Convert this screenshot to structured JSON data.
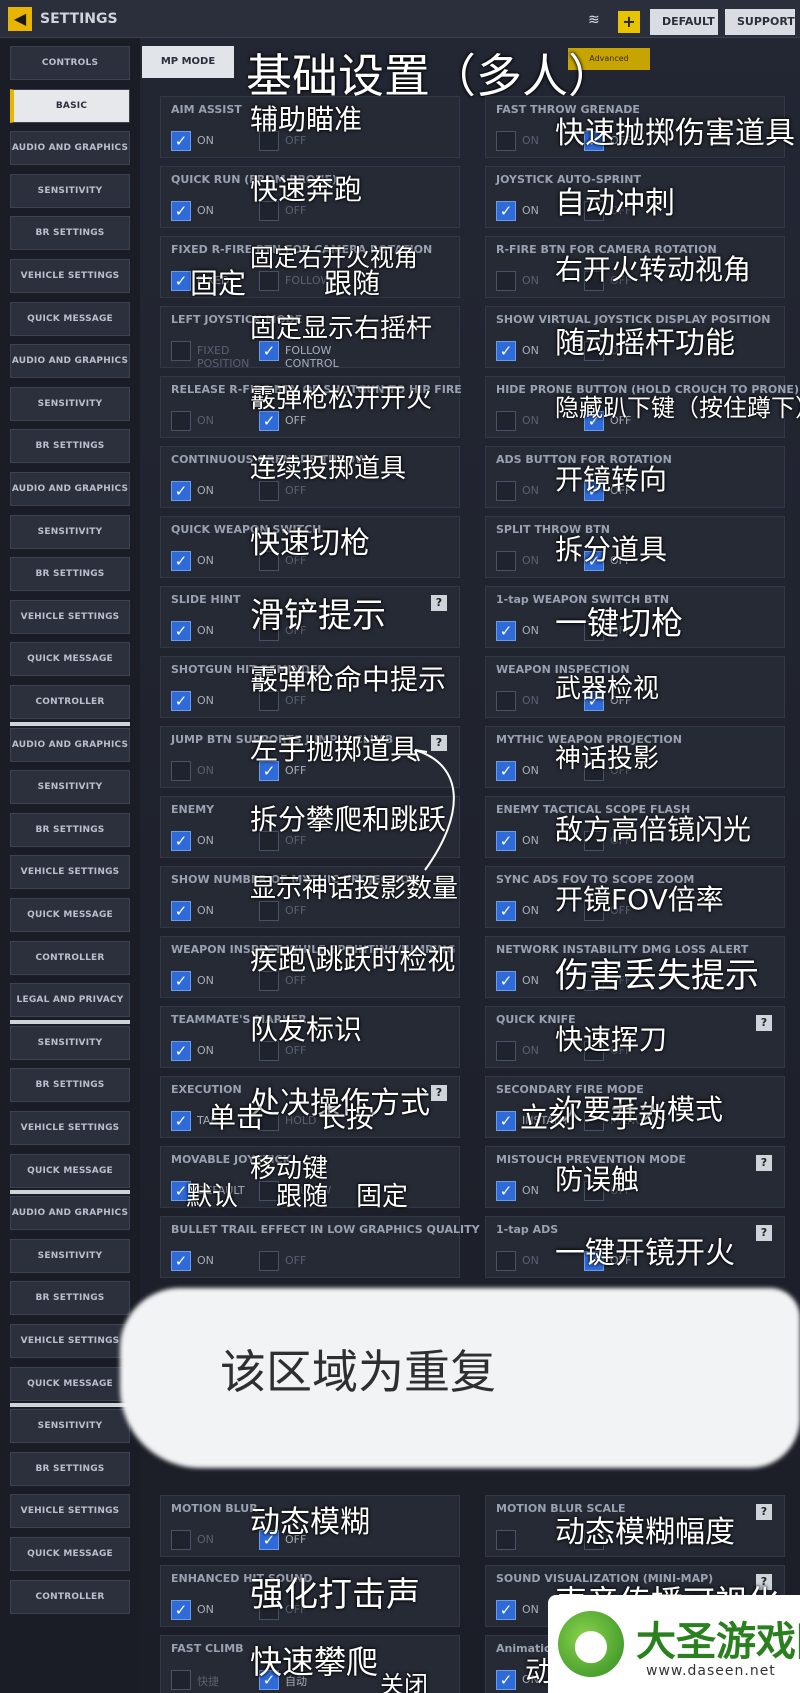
{
  "topbar": {
    "back_icon": "back-arrow-icon",
    "title": "SETTINGS",
    "wifi_icon": "signal-icon",
    "plus": "+",
    "default_label": "DEFAULT",
    "support_label": "SUPPORT"
  },
  "sidebar": {
    "items": [
      "CONTROLS",
      "BASIC",
      "AUDIO AND GRAPHICS",
      "SENSITIVITY",
      "BR SETTINGS",
      "VEHICLE SETTINGS",
      "QUICK MESSAGE",
      "AUDIO AND GRAPHICS",
      "SENSITIVITY",
      "BR SETTINGS",
      "AUDIO AND GRAPHICS",
      "SENSITIVITY",
      "BR SETTINGS",
      "VEHICLE SETTINGS",
      "QUICK MESSAGE",
      "CONTROLLER",
      "AUDIO AND GRAPHICS",
      "SENSITIVITY",
      "BR SETTINGS",
      "VEHICLE SETTINGS",
      "QUICK MESSAGE",
      "CONTROLLER",
      "LEGAL AND PRIVACY",
      "SENSITIVITY",
      "BR SETTINGS",
      "VEHICLE SETTINGS",
      "QUICK MESSAGE",
      "AUDIO AND GRAPHICS",
      "SENSITIVITY",
      "BR SETTINGS",
      "VEHICLE SETTINGS",
      "QUICK MESSAGE",
      "SENSITIVITY",
      "BR SETTINGS",
      "VEHICLE SETTINGS",
      "QUICK MESSAGE",
      "CONTROLLER"
    ]
  },
  "main": {
    "mode_tab": "MP MODE",
    "heading": "基础设置（多人）",
    "yellow_tab": "Advanced"
  },
  "cards": [
    {
      "title": "AIM ASSIST",
      "opts": [
        "ON",
        "OFF"
      ],
      "checked": [
        true,
        false
      ],
      "help": false,
      "anno": "辅助瞄准"
    },
    {
      "title": "FAST THROW GRENADE",
      "opts": [
        "ON",
        "OFF"
      ],
      "checked": [
        false,
        true
      ],
      "help": false,
      "anno": "快速抛掷伤害道具"
    },
    {
      "title": "QUICK RUN (FROM PRONE)",
      "opts": [
        "ON",
        "OFF"
      ],
      "checked": [
        true,
        false
      ],
      "help": false,
      "anno": "快速奔跑"
    },
    {
      "title": "JOYSTICK AUTO-SPRINT",
      "opts": [
        "ON",
        "OFF"
      ],
      "checked": [
        true,
        false
      ],
      "help": false,
      "anno": "自动冲刺"
    },
    {
      "title": "FIXED R-FIRE BTN FOR CAMERA ROTATION",
      "opts": [
        "FIXED",
        "FOLLOW"
      ],
      "checked": [
        true,
        false
      ],
      "help": false,
      "anno": "固定右开火视角"
    },
    {
      "title": "R-FIRE BTN FOR CAMERA ROTATION",
      "opts": [
        "ON",
        "OFF"
      ],
      "checked": [
        false,
        false
      ],
      "help": false,
      "anno": "右开火转动视角"
    },
    {
      "title": "LEFT JOYSTICK MODE",
      "opts": [
        "FIXED POSITION",
        "FOLLOW CONTROL"
      ],
      "checked": [
        false,
        true
      ],
      "help": false,
      "anno": "固定显示右摇杆"
    },
    {
      "title": "SHOW VIRTUAL JOYSTICK DISPLAY POSITION",
      "opts": [
        "ON",
        "OFF"
      ],
      "checked": [
        true,
        false
      ],
      "help": false,
      "anno": "随动摇杆功能"
    },
    {
      "title": "RELEASE R-FIRE BTN OF SHOTGUN TO HIP FIRE",
      "opts": [
        "ON",
        "OFF"
      ],
      "checked": [
        false,
        true
      ],
      "help": false,
      "anno": "霰弹枪松开开火"
    },
    {
      "title": "HIDE PRONE BUTTON (HOLD CROUCH TO PRONE)",
      "opts": [
        "ON",
        "OFF"
      ],
      "checked": [
        false,
        true
      ],
      "help": false,
      "anno": "隐藏趴下键（按住蹲下）"
    },
    {
      "title": "CONTINUOUS GRENADE THROW",
      "opts": [
        "ON",
        "OFF"
      ],
      "checked": [
        true,
        false
      ],
      "help": false,
      "anno": "连续投掷道具"
    },
    {
      "title": "ADS BUTTON FOR ROTATION",
      "opts": [
        "ON",
        "OFF"
      ],
      "checked": [
        false,
        true
      ],
      "help": false,
      "anno": "开镜转向"
    },
    {
      "title": "QUICK WEAPON SWITCH",
      "opts": [
        "ON",
        "OFF"
      ],
      "checked": [
        true,
        false
      ],
      "help": false,
      "anno": "快速切枪"
    },
    {
      "title": "SPLIT THROW BTN",
      "opts": [
        "ON",
        "OFF"
      ],
      "checked": [
        false,
        true
      ],
      "help": false,
      "anno": "拆分道具"
    },
    {
      "title": "SLIDE HINT",
      "opts": [
        "ON",
        "OFF"
      ],
      "checked": [
        true,
        false
      ],
      "help": true,
      "anno": "滑铲提示"
    },
    {
      "title": "1-tap WEAPON SWITCH BTN",
      "opts": [
        "ON",
        "OFF"
      ],
      "checked": [
        true,
        false
      ],
      "help": false,
      "anno": "一键切枪"
    },
    {
      "title": "SHOTGUN HIT REMINDER",
      "opts": [
        "ON",
        "OFF"
      ],
      "checked": [
        true,
        false
      ],
      "help": false,
      "anno": "霰弹枪命中提示"
    },
    {
      "title": "WEAPON INSPECTION",
      "opts": [
        "ON",
        "OFF"
      ],
      "checked": [
        false,
        true
      ],
      "help": false,
      "anno": "武器检视"
    },
    {
      "title": "JUMP BTN SUPPORTS JUMP & CLIMB",
      "opts": [
        "ON",
        "OFF"
      ],
      "checked": [
        false,
        true
      ],
      "help": true,
      "anno": "左手抛掷道具"
    },
    {
      "title": "MYTHIC WEAPON PROJECTION",
      "opts": [
        "ON",
        "OFF"
      ],
      "checked": [
        true,
        false
      ],
      "help": false,
      "anno": "神话投影"
    },
    {
      "title": "ENEMY",
      "opts": [
        "ON",
        "OFF"
      ],
      "checked": [
        true,
        false
      ],
      "help": false,
      "anno": "拆分攀爬和跳跃"
    },
    {
      "title": "ENEMY TACTICAL SCOPE FLASH",
      "opts": [
        "ON",
        "OFF"
      ],
      "checked": [
        true,
        false
      ],
      "help": false,
      "anno": "敌方高倍镜闪光"
    },
    {
      "title": "SHOW NUMBER OF MYTHIC PROJECTION",
      "opts": [
        "ON",
        "OFF"
      ],
      "checked": [
        true,
        false
      ],
      "help": false,
      "anno": "显示神话投影数量"
    },
    {
      "title": "SYNC ADS FOV TO SCOPE ZOOM",
      "opts": [
        "ON",
        "OFF"
      ],
      "checked": [
        true,
        false
      ],
      "help": false,
      "anno": "开镜FOV倍率"
    },
    {
      "title": "WEAPON INSPECT WHILE SPRINTING/JUMPING",
      "opts": [
        "ON",
        "OFF"
      ],
      "checked": [
        true,
        false
      ],
      "help": false,
      "anno": "疾跑\\跳跃时检视"
    },
    {
      "title": "NETWORK INSTABILITY DMG LOSS ALERT",
      "opts": [
        "ON",
        "OFF"
      ],
      "checked": [
        true,
        false
      ],
      "help": false,
      "anno": "伤害丢失提示"
    },
    {
      "title": "TEAMMATE'S MARKER",
      "opts": [
        "ON",
        "OFF"
      ],
      "checked": [
        true,
        false
      ],
      "help": false,
      "anno": "队友标识"
    },
    {
      "title": "QUICK KNIFE",
      "opts": [
        "ON",
        "OFF"
      ],
      "checked": [
        false,
        false
      ],
      "help": true,
      "anno": "快速挥刀"
    },
    {
      "title": "EXECUTION",
      "opts": [
        "TAP",
        "HOLD"
      ],
      "checked": [
        true,
        false
      ],
      "help": true,
      "anno": "处决操作方式"
    },
    {
      "title": "SECONDARY FIRE MODE",
      "opts": [
        "INSTANT",
        "MANUAL"
      ],
      "checked": [
        true,
        false
      ],
      "help": false,
      "anno": "次要开火模式"
    },
    {
      "title": "MOVABLE JOYSTICK",
      "opts": [
        "DEFAULT",
        "FOLLOW"
      ],
      "checked": [
        true,
        false
      ],
      "help": false,
      "anno": "移动键"
    },
    {
      "title": "MISTOUCH PREVENTION MODE",
      "opts": [
        "ON",
        "OFF"
      ],
      "checked": [
        true,
        false
      ],
      "help": true,
      "anno": "防误触"
    },
    {
      "title": "BULLET TRAIL EFFECT IN LOW GRAPHICS QUALITY",
      "opts": [
        "ON",
        "OFF"
      ],
      "checked": [
        true,
        false
      ],
      "help": false,
      "anno": ""
    },
    {
      "title": "1-tap ADS",
      "opts": [
        "ON",
        "OFF"
      ],
      "checked": [
        false,
        true
      ],
      "help": true,
      "anno": "一键开镜开火"
    },
    {
      "title": "MOTION BLUR",
      "opts": [
        "ON",
        "OFF"
      ],
      "checked": [
        false,
        true
      ],
      "help": false,
      "anno": "动态模糊"
    },
    {
      "title": "MOTION BLUR SCALE",
      "opts": [
        "",
        ""
      ],
      "checked": [
        false,
        false
      ],
      "help": true,
      "anno": "动态模糊幅度"
    },
    {
      "title": "ENHANCED HIT SOUND",
      "opts": [
        "ON",
        "OFF"
      ],
      "checked": [
        true,
        false
      ],
      "help": false,
      "anno": "强化打击声"
    },
    {
      "title": "SOUND VISUALIZATION (MINI-MAP)",
      "opts": [
        "ON",
        "OFF"
      ],
      "checked": [
        true,
        false
      ],
      "help": true,
      "anno": "声音传播可视化"
    },
    {
      "title": "FAST CLIMB",
      "opts": [
        "快捷",
        "自动"
      ],
      "checked": [
        false,
        true
      ],
      "help": false,
      "anno": "快速攀爬"
    },
    {
      "title": "Animation",
      "opts": [
        "ON",
        "OFF"
      ],
      "checked": [
        true,
        false
      ],
      "help": false,
      "anno": ""
    }
  ],
  "extra_annos": {
    "fixed": "固定",
    "follow": "跟随",
    "tap": "单击",
    "hold": "长按",
    "instant": "立刻",
    "manual": "手动",
    "default": "默认",
    "follow2": "跟随",
    "fixed2": "固定",
    "close": "关闭",
    "last": "动"
  },
  "blob_text": "该区域为重复",
  "watermark": {
    "name": "大圣游戏网",
    "url": "www.daseen.net",
    "logo_icon": "monkey-logo-icon"
  },
  "colors": {
    "accent": "#e8b600",
    "check": "#2f6ad9",
    "card": "#262a35"
  }
}
